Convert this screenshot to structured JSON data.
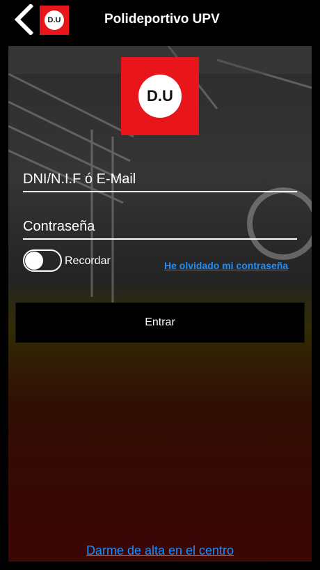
{
  "header": {
    "title": "Polideportivo UPV",
    "logo_text": "D.U",
    "back_icon": "chevron-left-icon"
  },
  "main": {
    "logo_text": "D.U",
    "username_placeholder": "DNI/N.I.F ó E-Mail",
    "password_placeholder": "Contraseña",
    "remember_label": "Recordar",
    "remember_checked": false,
    "forgot_link": "He olvidado mi contraseña",
    "enter_button": "Entrar",
    "signup_link": "Darme de alta en el centro"
  },
  "colors": {
    "brand_red": "#e8161b",
    "link_blue": "#1e8fff",
    "bar_black": "#000000"
  }
}
